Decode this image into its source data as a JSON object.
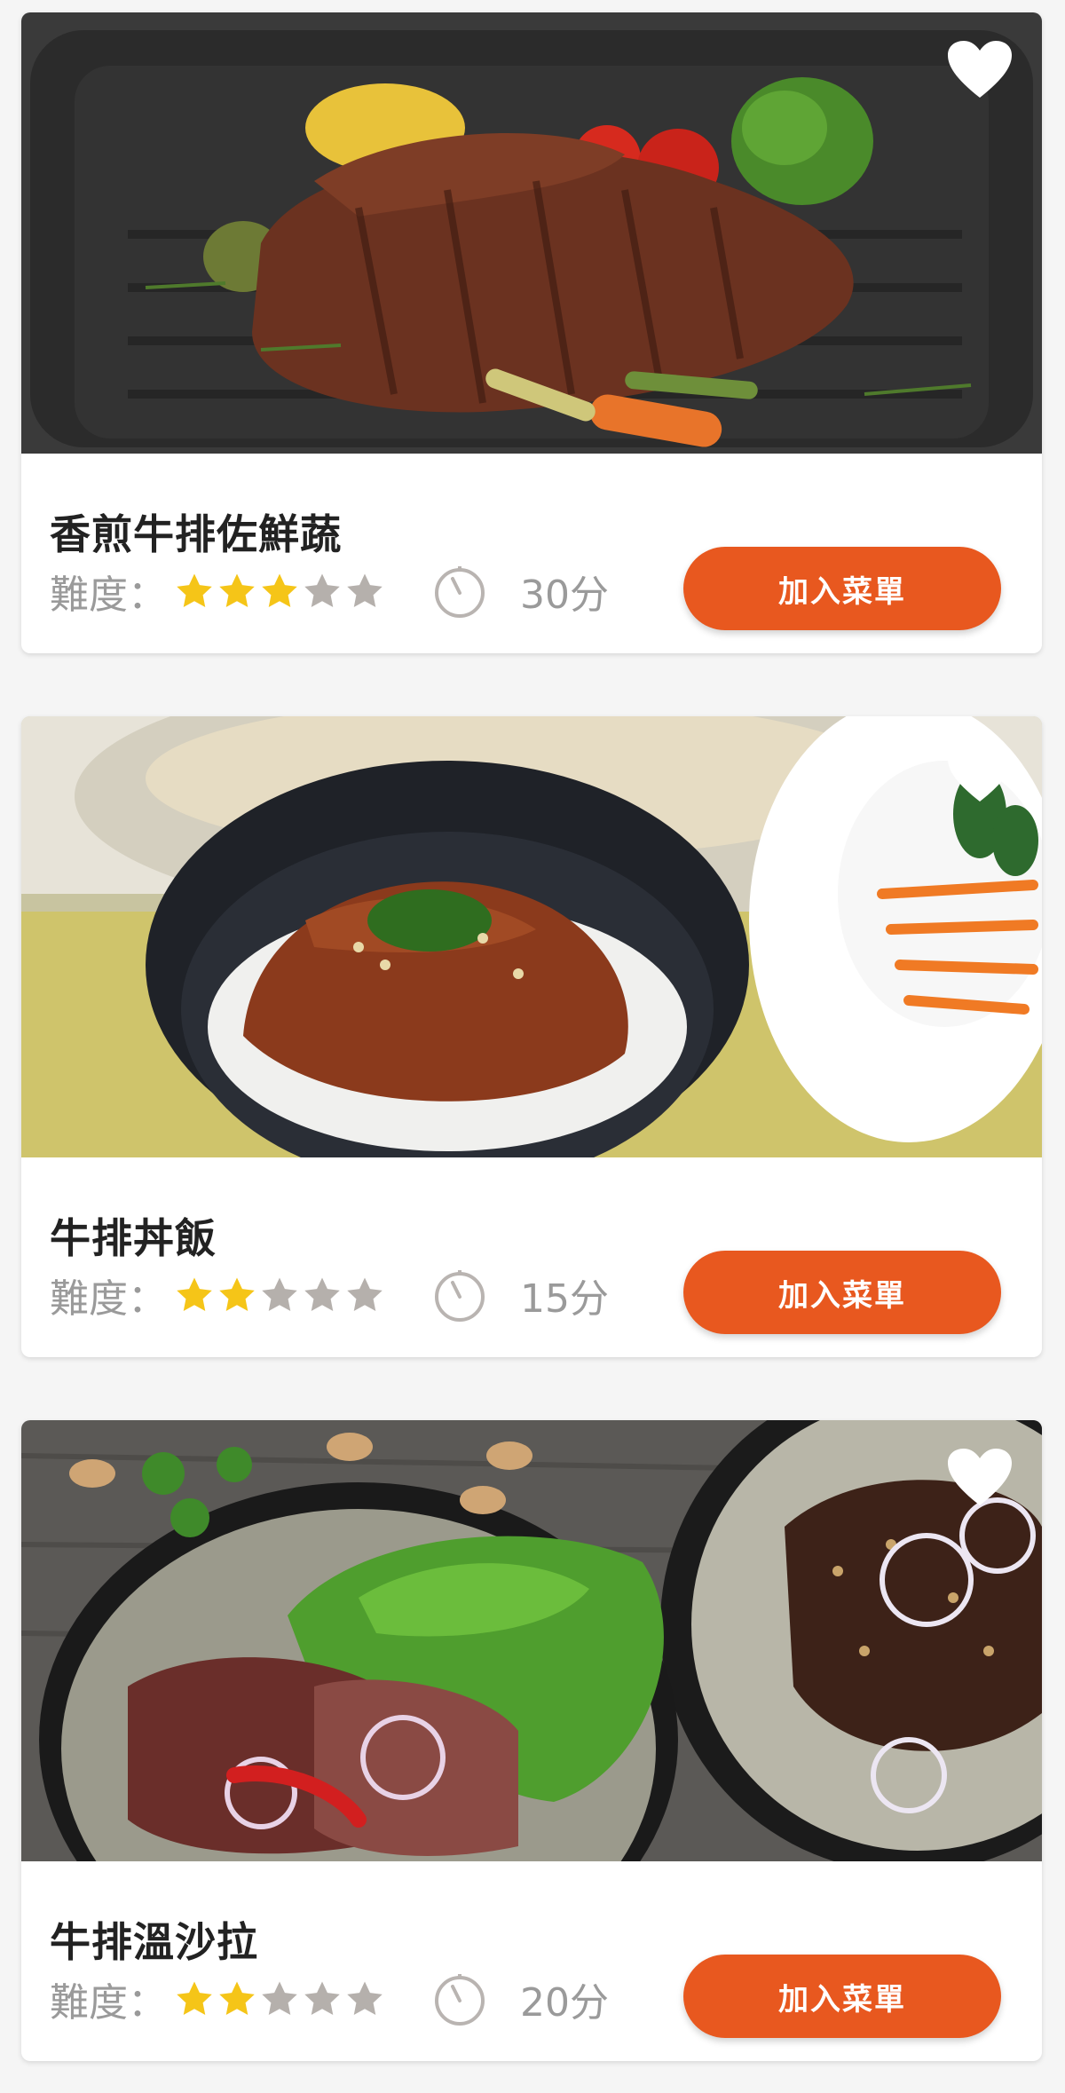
{
  "difficulty_label": "難度：",
  "add_button_label": "加入菜單",
  "colors": {
    "accent": "#e8581f",
    "star_on": "#f5c518",
    "star_off": "#b5b0ac",
    "muted_text": "#9a9a9a"
  },
  "recipes": [
    {
      "title": "香煎牛排佐鮮蔬",
      "difficulty_stars": 3,
      "max_stars": 5,
      "time": "30分",
      "favorited": true,
      "image": "grilled-steak-with-vegetables-photo"
    },
    {
      "title": "牛排丼飯",
      "difficulty_stars": 2,
      "max_stars": 5,
      "time": "15分",
      "favorited": true,
      "image": "beef-rice-bowl-photo"
    },
    {
      "title": "牛排溫沙拉",
      "difficulty_stars": 2,
      "max_stars": 5,
      "time": "20分",
      "favorited": true,
      "image": "steak-warm-salad-photo"
    }
  ]
}
